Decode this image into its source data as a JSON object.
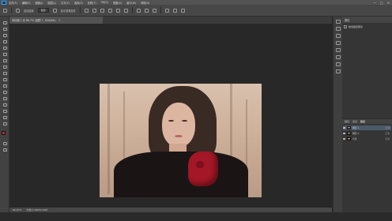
{
  "app": {
    "menu_items": [
      "文件(F)",
      "编辑(E)",
      "图像(I)",
      "图层(L)",
      "文字(Y)",
      "选择(S)",
      "滤镜(T)",
      "3D(D)",
      "视图(V)",
      "窗口(W)",
      "帮助(H)"
    ],
    "window_controls": [
      "—",
      "□",
      "✕"
    ]
  },
  "options_bar": {
    "items": [
      "自动选择",
      "图层",
      "显示变换控件"
    ]
  },
  "document_tab": {
    "title": "未标题-1 @ 66.7% (图层 1, RGB/8#)",
    "close": "×"
  },
  "status_bar": {
    "zoom": "66.67%",
    "doc_size": "文档:1.46M/2.93M"
  },
  "right_panel": {
    "header": "属性",
    "rows": [
      "像素图层属性",
      "",
      "",
      "",
      ""
    ]
  },
  "layers_panel": {
    "tabs": [
      "图层",
      "通道",
      "路径"
    ],
    "active_tab": 2,
    "layers": [
      {
        "name": "图层 1",
        "mode": "正常"
      },
      {
        "name": "图层 2",
        "mode": "正常"
      },
      {
        "name": "背景",
        "mode": "正常"
      }
    ]
  },
  "colors": {
    "foreground": "#d02030",
    "background": "#f0f0f0",
    "ui_dark": "#282828",
    "ui_panel": "#353535"
  }
}
